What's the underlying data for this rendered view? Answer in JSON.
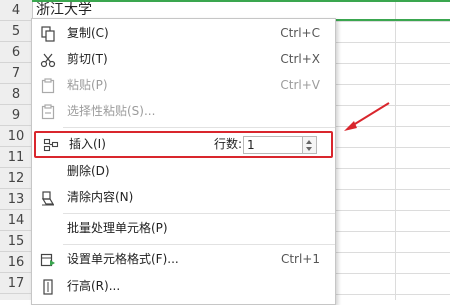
{
  "sheet": {
    "row_numbers": [
      "4",
      "5",
      "6",
      "7",
      "8",
      "9",
      "10",
      "11",
      "12",
      "13",
      "14",
      "15",
      "16",
      "17"
    ],
    "row4_cell": "浙江大学",
    "accent_green": "#3aa64f"
  },
  "menu": {
    "items": [
      {
        "label": "复制(C)",
        "shortcut": "Ctrl+C",
        "icon": "copy-icon",
        "disabled": false
      },
      {
        "label": "剪切(T)",
        "shortcut": "Ctrl+X",
        "icon": "scissors-icon",
        "disabled": false
      },
      {
        "label": "粘贴(P)",
        "shortcut": "Ctrl+V",
        "icon": "paste-icon",
        "disabled": true
      },
      {
        "label": "选择性粘贴(S)...",
        "shortcut": "",
        "icon": "paste-special-icon",
        "disabled": true
      },
      {
        "label": "插入(I)",
        "shortcut": "",
        "icon": "insert-icon",
        "disabled": false,
        "rows_label": "行数:",
        "rows_value": "1"
      },
      {
        "label": "删除(D)",
        "shortcut": "",
        "icon": "",
        "disabled": false
      },
      {
        "label": "清除内容(N)",
        "shortcut": "",
        "icon": "eraser-icon",
        "disabled": false
      },
      {
        "label": "批量处理单元格(P)",
        "shortcut": "",
        "icon": "",
        "disabled": false
      },
      {
        "label": "设置单元格格式(F)...",
        "shortcut": "Ctrl+1",
        "icon": "format-cells-icon",
        "disabled": false
      },
      {
        "label": "行高(R)...",
        "shortcut": "",
        "icon": "row-height-icon",
        "disabled": false
      }
    ],
    "highlight_color": "#d9262d"
  }
}
